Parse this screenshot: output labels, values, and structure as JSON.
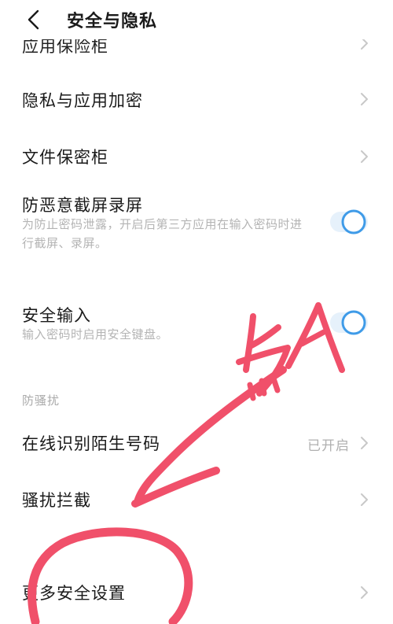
{
  "header": {
    "title": "安全与隐私"
  },
  "rows": {
    "partial": "应用保险柜",
    "privacy_encrypt": "隐私与应用加密",
    "file_vault": "文件保密柜",
    "anti_screen": {
      "title": "防恶意截屏录屏",
      "subtitle": "为防止密码泄露，开启后第三方应用在输入密码时进行截屏、录屏。",
      "enabled": true
    },
    "secure_input": {
      "title": "安全输入",
      "subtitle": "输入密码时启用安全键盘。",
      "enabled": true
    },
    "section_harass": "防骚扰",
    "identify_number": {
      "title": "在线识别陌生号码",
      "status": "已开启"
    },
    "harass_block": "骚扰拦截",
    "more_security": "更多安全设置"
  },
  "annotation": {
    "handwriting": "点",
    "color": "#f0506a"
  },
  "colors": {
    "toggle_accent": "#3f9be8",
    "text_primary": "#1a1a1a",
    "text_secondary": "#b4b4b4",
    "chevron": "#c8c8c8"
  }
}
